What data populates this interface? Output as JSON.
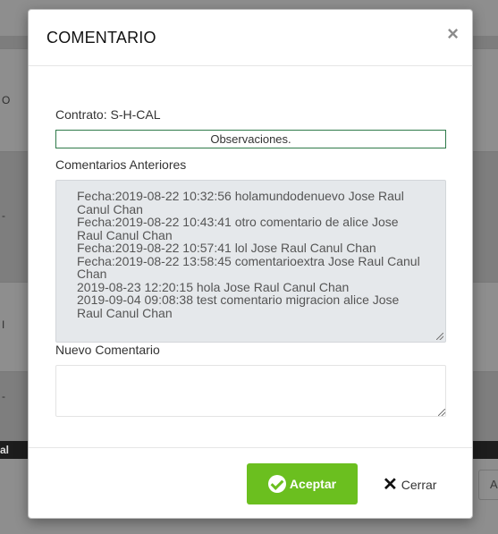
{
  "background": {
    "row_texts": [
      "O",
      "-",
      "I",
      "-"
    ],
    "footer_text": "al",
    "side_button_text": "A"
  },
  "modal": {
    "title": "COMENTARIO",
    "close_glyph": "×",
    "contract_label": "Contrato: S-H-CAL",
    "observations_label": "Observaciones.",
    "previous_comments_label": "Comentarios Anteriores",
    "previous_comments": [
      "Fecha:2019-08-22 10:32:56 holamundodenuevo Jose Raul Canul Chan",
      "Fecha:2019-08-22 10:43:41 otro comentario de alice Jose Raul Canul Chan",
      "Fecha:2019-08-22 10:57:41 lol Jose Raul Canul Chan",
      "Fecha:2019-08-22 13:58:45 comentarioextra Jose Raul Canul Chan",
      "2019-08-23 12:20:15 hola Jose Raul Canul Chan",
      "2019-09-04 09:08:38 test comentario migracion alice Jose Raul Canul Chan"
    ],
    "new_comment_label": "Nuevo Comentario",
    "new_comment_value": "",
    "accept_label": "Aceptar",
    "cancel_label": "Cerrar"
  },
  "colors": {
    "accept_button": "#6bbf1f",
    "observations_border": "#2f7a4a",
    "previous_comments_bg": "#e5e8eb"
  },
  "icons": {
    "close": "close-icon",
    "accept": "check-circle-icon",
    "cancel": "x-icon"
  }
}
